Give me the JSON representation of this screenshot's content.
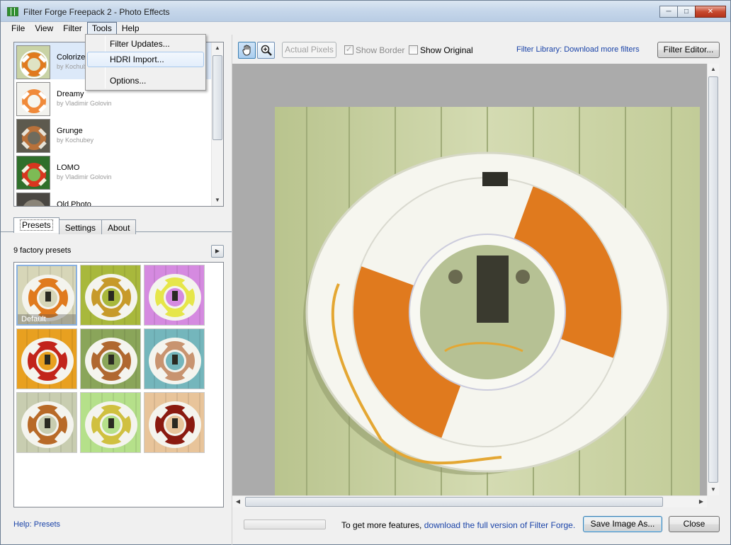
{
  "window": {
    "title": "Filter Forge Freepack 2 - Photo Effects",
    "controls": [
      "minimize",
      "maximize",
      "close"
    ]
  },
  "menu": {
    "items": [
      "File",
      "View",
      "Filter",
      "Tools",
      "Help"
    ],
    "open": "Tools",
    "dropdown": [
      "Filter Updates...",
      "HDRI Import...",
      "Options..."
    ],
    "hovered": "HDRI Import..."
  },
  "filters": [
    {
      "name": "Colorize",
      "author": "by Kochubey",
      "selected": true
    },
    {
      "name": "Dreamy",
      "author": "by Vladimir Golovin"
    },
    {
      "name": "Grunge",
      "author": "by Kochubey"
    },
    {
      "name": "LOMO",
      "author": "by Vladimir Golovin"
    },
    {
      "name": "Old Photo",
      "author": ""
    }
  ],
  "tabs": {
    "items": [
      "Presets",
      "Settings",
      "About"
    ],
    "active": "Presets"
  },
  "presets": {
    "count_label": "9 factory presets",
    "items": [
      {
        "label": "Default",
        "tint": "#d7d6b8",
        "ring": "#e07a1e",
        "selected": true
      },
      {
        "label": "",
        "tint": "#a8b83c",
        "ring": "#c79a2a"
      },
      {
        "label": "",
        "tint": "#d58ae0",
        "ring": "#e6e64a"
      },
      {
        "label": "",
        "tint": "#e8a020",
        "ring": "#c2241b"
      },
      {
        "label": "",
        "tint": "#8aa55a",
        "ring": "#b06830"
      },
      {
        "label": "",
        "tint": "#74b6bc",
        "ring": "#c89470"
      },
      {
        "label": "",
        "tint": "#c8cdb0",
        "ring": "#b86a28"
      },
      {
        "label": "",
        "tint": "#b5e08a",
        "ring": "#d0c040"
      },
      {
        "label": "",
        "tint": "#e8c49a",
        "ring": "#8a1a10"
      }
    ]
  },
  "help_link": "Help: Presets",
  "toolbar": {
    "hand_tool": "hand-icon",
    "zoom_tool": "zoom-in-icon",
    "actual_pixels": "Actual Pixels",
    "show_border": "Show Border",
    "show_border_checked": true,
    "show_original": "Show Original",
    "show_original_checked": false,
    "library_link": "Filter Library: Download more filters",
    "filter_editor": "Filter Editor..."
  },
  "footer": {
    "promo_prefix": "To get more features,",
    "promo_link": "download the full version of Filter Forge.",
    "save_button": "Save Image As...",
    "close_button": "Close"
  },
  "colors": {
    "link": "#1a43a8",
    "preview_bg": "#ababab",
    "ring_orange": "#e07a1e",
    "wall_green": "#c9d3a6"
  }
}
